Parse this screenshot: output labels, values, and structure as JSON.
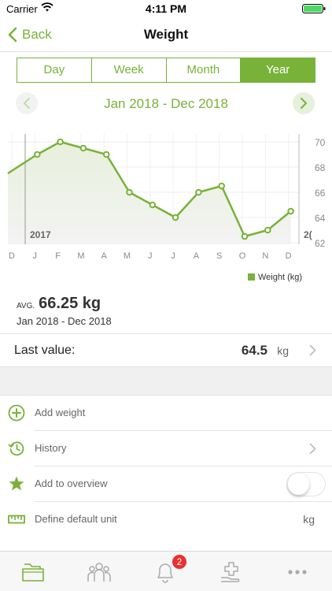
{
  "status_bar": {
    "carrier": "Carrier",
    "time": "4:11 PM"
  },
  "nav": {
    "back_label": "Back",
    "title": "Weight"
  },
  "segments": [
    {
      "label": "Day",
      "active": false
    },
    {
      "label": "Week",
      "active": false
    },
    {
      "label": "Month",
      "active": false
    },
    {
      "label": "Year",
      "active": true
    }
  ],
  "date_range": "Jan 2018 - Dec 2018",
  "chart_data": {
    "type": "line",
    "x_tick_labels": [
      "D",
      "J",
      "F",
      "M",
      "A",
      "M",
      "J",
      "J",
      "A",
      "S",
      "O",
      "N",
      "D"
    ],
    "y_tick_labels": [
      "70",
      "68",
      "66",
      "64",
      "62"
    ],
    "ylim": [
      62,
      70
    ],
    "year_label_left": "2017",
    "year_label_right": "2(",
    "series": [
      {
        "name": "Weight (kg)",
        "color": "#78b239",
        "lead_in": {
          "label": "Dec 2017",
          "value": 67.5
        },
        "points": [
          {
            "x": "Jan",
            "y": 69.0
          },
          {
            "x": "Feb",
            "y": 70.0
          },
          {
            "x": "Mar",
            "y": 69.5
          },
          {
            "x": "Apr",
            "y": 69.0
          },
          {
            "x": "May",
            "y": 66.0
          },
          {
            "x": "Jun",
            "y": 65.0
          },
          {
            "x": "Jul",
            "y": 64.0
          },
          {
            "x": "Aug",
            "y": 66.0
          },
          {
            "x": "Sep",
            "y": 66.5
          },
          {
            "x": "Oct",
            "y": 62.5
          },
          {
            "x": "Nov",
            "y": 63.0
          },
          {
            "x": "Dec",
            "y": 64.5
          }
        ]
      }
    ],
    "legend": "bottom-right",
    "grid": true
  },
  "summary": {
    "avg_prefix": "AVG.",
    "avg_value": "66.25 kg",
    "avg_range": "Jan 2018 - Dec 2018"
  },
  "last_value": {
    "label": "Last value:",
    "value": "64.5",
    "unit": "kg"
  },
  "menu": {
    "add_weight": "Add weight",
    "history": "History",
    "add_overview": "Add to overview",
    "default_unit": "Define default unit",
    "default_unit_value": "kg",
    "overview_enabled": false
  },
  "tab_bar": {
    "notification_count": "2",
    "tabs": [
      "folder-icon",
      "people-icon",
      "bell-icon",
      "medical-icon",
      "more-icon"
    ]
  },
  "colors": {
    "accent": "#78b239",
    "badge": "#e8312f"
  }
}
